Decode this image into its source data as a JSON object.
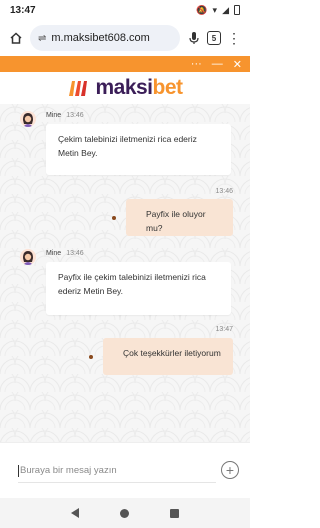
{
  "status_bar": {
    "time": "13:47"
  },
  "browser": {
    "url": "m.maksibet608.com",
    "tab_count": "5"
  },
  "brand": {
    "part1": "maksi",
    "part2": "bet"
  },
  "messages": [
    {
      "sender": "Mine",
      "time": "13:46",
      "text": "Çekim talebinizi iletmenizi rica ederiz Metin Bey."
    },
    {
      "time": "13:46",
      "text": "Payfix ile oluyor mu?"
    },
    {
      "sender": "Mine",
      "time": "13:46",
      "text": "Payfix ile çekim talebinizi iletmenizi rica ederiz Metin Bey."
    },
    {
      "time": "13:47",
      "text": "Çok teşekkürler iletiyorum"
    }
  ],
  "composer": {
    "placeholder": "Buraya bir mesaj yazın"
  },
  "colors": {
    "accent": "#f7942e",
    "brand_purple": "#3b1e58",
    "bubble_out": "#f9e4d4"
  }
}
